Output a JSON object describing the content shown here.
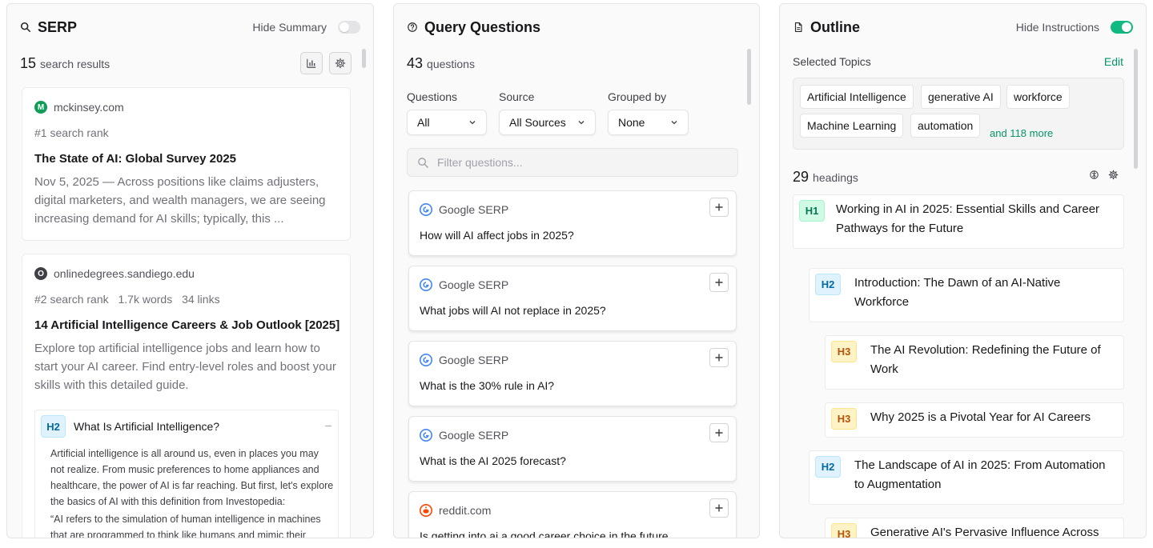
{
  "serp": {
    "title": "SERP",
    "toggle_label": "Hide Summary",
    "count": "15",
    "count_label": "search results",
    "results": [
      {
        "domain": "mckinsey.com",
        "favicon_letter": "M",
        "favicon_color": "#0f9d58",
        "rank": "#1 search rank",
        "title": "The State of AI: Global Survey 2025",
        "snippet": "Nov 5, 2025 — Across positions like claims adjusters, digital marketers, and wealth managers, we are seeing increasing demand for AI skills; typically, this ..."
      },
      {
        "domain": "onlinedegrees.sandiego.edu",
        "favicon_letter": "O",
        "favicon_color": "#3f3f46",
        "rank": "#2 search rank",
        "words": "1.7k words",
        "links": "34 links",
        "title": "14 Artificial Intelligence Careers & Job Outlook [2025]",
        "snippet": "Explore top artificial intelligence jobs and learn how to start your AI career. Find entry-level roles and boost your skills with this detailed guide.",
        "heading": {
          "level": "H2",
          "text": "What Is Artificial Intelligence?",
          "collapse": "–",
          "body": "Artificial intelligence is all around us, even in places you may not realize. From music preferences to home appliances and healthcare, the power of AI is far reaching. But first, let's explore the basics of AI with this definition from Investopedia:",
          "quote": "“AI refers to the simulation of human intelligence in machines that are programmed to think like humans and mimic their"
        }
      }
    ]
  },
  "questions": {
    "title": "Query Questions",
    "count": "43",
    "count_label": "questions",
    "filters": {
      "questions_label": "Questions",
      "questions_value": "All",
      "source_label": "Source",
      "source_value": "All Sources",
      "group_label": "Grouped by",
      "group_value": "None"
    },
    "search_placeholder": "Filter questions...",
    "items": [
      {
        "source": "Google SERP",
        "text": "How will AI affect jobs in 2025?"
      },
      {
        "source": "Google SERP",
        "text": "What jobs will AI not replace in 2025?"
      },
      {
        "source": "Google SERP",
        "text": "What is the 30% rule in AI?"
      },
      {
        "source": "Google SERP",
        "text": "What is the AI 2025 forecast?"
      },
      {
        "source": "reddit.com",
        "text": "Is getting into ai a good career choice in the future"
      }
    ]
  },
  "outline": {
    "title": "Outline",
    "toggle_label": "Hide Instructions",
    "selected_topics_label": "Selected Topics",
    "edit_label": "Edit",
    "topics": [
      "Artificial Intelligence",
      "generative AI",
      "workforce",
      "Machine Learning",
      "automation"
    ],
    "more_label": "and 118 more",
    "count": "29",
    "count_label": "headings",
    "headings": [
      {
        "level": "H1",
        "text": "Working in AI in 2025: Essential Skills and Career Pathways for the Future"
      },
      {
        "level": "H2",
        "text": "Introduction: The Dawn of an AI-Native Workforce"
      },
      {
        "level": "H3",
        "text": "The AI Revolution: Redefining the Future of Work"
      },
      {
        "level": "H3",
        "text": "Why 2025 is a Pivotal Year for AI Careers"
      },
      {
        "level": "H2",
        "text": "The Landscape of AI in 2025: From Automation to Augmentation"
      },
      {
        "level": "H3",
        "text": "Generative AI's Pervasive Influence Across"
      }
    ]
  },
  "colors": {
    "accent": "#10b981",
    "google_blue": "#4285f4",
    "reddit_orange": "#ff4500"
  }
}
